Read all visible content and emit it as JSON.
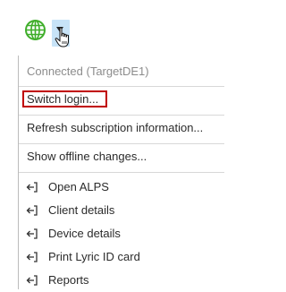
{
  "toolbar": {
    "globe_icon": "globe-icon",
    "globe_color": "#3fae2a",
    "dropdown_icon": "chevron-down-icon",
    "dropdown_bg": "#c7e3f7"
  },
  "menu": {
    "status": "Connected (TargetDE1)",
    "actions": [
      "Switch login...",
      "Refresh subscription information...",
      "Show offline changes..."
    ],
    "links": [
      "Open ALPS",
      "Client details",
      "Device details",
      "Print Lyric ID card",
      "Reports"
    ],
    "link_icon": "external-link-arrow-icon",
    "highlight_color": "#c00000"
  }
}
